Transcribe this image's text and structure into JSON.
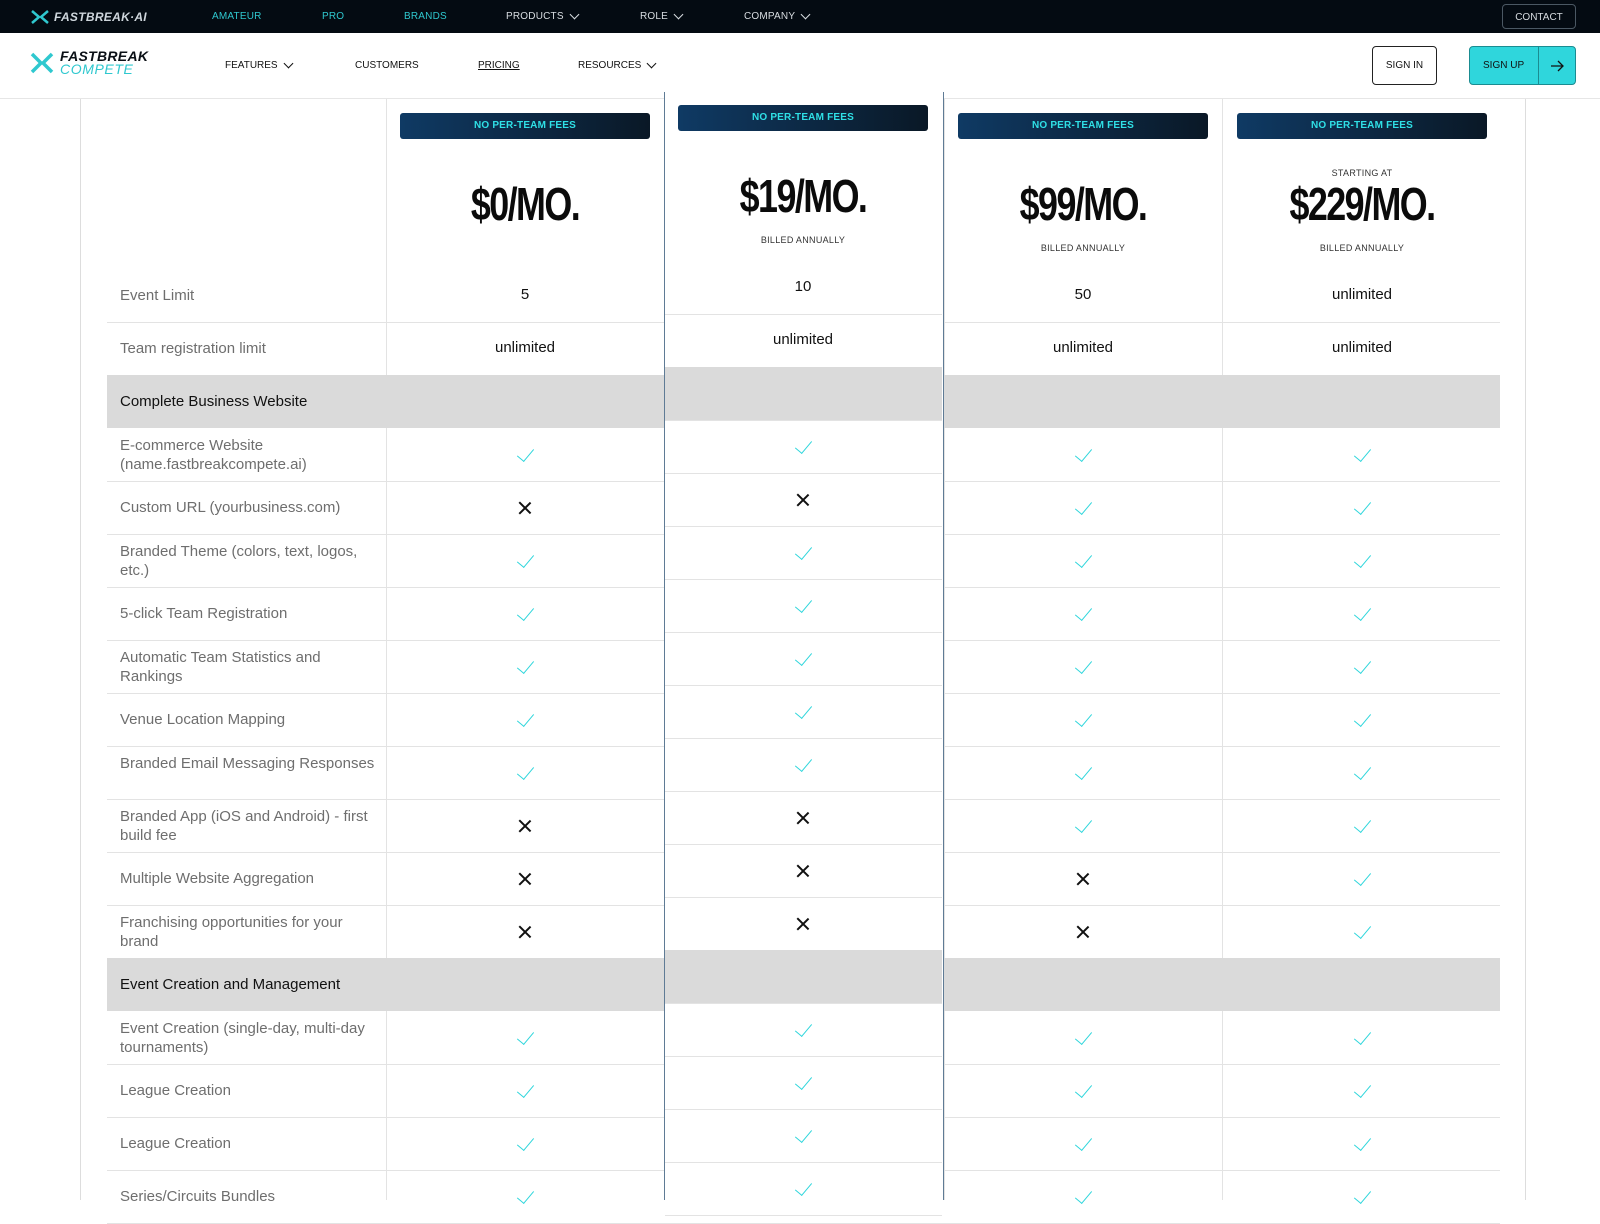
{
  "topbar": {
    "logo": "FASTBREAK·AI",
    "nav": [
      {
        "label": "AMATEUR"
      },
      {
        "label": "PRO"
      },
      {
        "label": "BRANDS"
      },
      {
        "label": "PRODUCTS"
      },
      {
        "label": "ROLE"
      },
      {
        "label": "COMPANY"
      }
    ],
    "contact_label": "CONTACT"
  },
  "mainnav": {
    "brand_line1": "FASTBREAK",
    "brand_line2": "COMPETE",
    "items": [
      {
        "label": "FEATURES"
      },
      {
        "label": "CUSTOMERS"
      },
      {
        "label": "PRICING"
      },
      {
        "label": "RESOURCES"
      }
    ],
    "signin_label": "SIGN IN",
    "signup_label": "SIGN UP"
  },
  "plans": [
    {
      "badge": "NO PER-TEAM FEES",
      "prefix": "",
      "price": "$0/MO.",
      "billing": ""
    },
    {
      "badge": "NO PER-TEAM FEES",
      "prefix": "",
      "price": "$19/MO.",
      "billing": "BILLED ANNUALLY"
    },
    {
      "badge": "NO PER-TEAM FEES",
      "prefix": "",
      "price": "$99/MO.",
      "billing": "BILLED ANNUALLY"
    },
    {
      "badge": "NO PER-TEAM FEES",
      "prefix": "STARTING AT",
      "price": "$229/MO.",
      "billing": "BILLED ANNUALLY"
    }
  ],
  "rows": [
    {
      "label": "Event Limit",
      "values": [
        "5",
        "10",
        "50",
        "unlimited"
      ]
    },
    {
      "label": "Team registration limit",
      "values": [
        "unlimited",
        "unlimited",
        "unlimited",
        "unlimited"
      ]
    },
    {
      "label": "Complete Business Website",
      "section": true
    },
    {
      "label": "E-commerce Website (name.fastbreakcompete.ai)",
      "values": [
        "check",
        "check",
        "check",
        "check"
      ]
    },
    {
      "label": "Custom URL (yourbusiness.com)",
      "values": [
        "x",
        "x",
        "check",
        "check"
      ]
    },
    {
      "label": "Branded Theme (colors, text, logos, etc.)",
      "values": [
        "check",
        "check",
        "check",
        "check"
      ]
    },
    {
      "label": "5-click Team Registration",
      "values": [
        "check",
        "check",
        "check",
        "check"
      ]
    },
    {
      "label": "Automatic Team Statistics and Rankings",
      "values": [
        "check",
        "check",
        "check",
        "check"
      ]
    },
    {
      "label": "Venue Location Mapping",
      "values": [
        "check",
        "check",
        "check",
        "check"
      ]
    },
    {
      "label": "Branded Email Messaging Responses",
      "values": [
        "check",
        "check",
        "check",
        "check"
      ]
    },
    {
      "label": "Branded App (iOS and Android) - first build fee",
      "values": [
        "x",
        "x",
        "check",
        "check"
      ]
    },
    {
      "label": "Multiple Website Aggregation",
      "values": [
        "x",
        "x",
        "x",
        "check"
      ]
    },
    {
      "label": "Franchising opportunities for your brand",
      "values": [
        "x",
        "x",
        "x",
        "check"
      ]
    },
    {
      "label": "Event Creation and Management",
      "section": true
    },
    {
      "label": "Event Creation (single-day, multi-day tournaments)",
      "values": [
        "check",
        "check",
        "check",
        "check"
      ]
    },
    {
      "label": "League Creation",
      "values": [
        "check",
        "check",
        "check",
        "check"
      ]
    },
    {
      "label": "League Creation",
      "values": [
        "check",
        "check",
        "check",
        "check"
      ]
    },
    {
      "label": "Series/Circuits Bundles",
      "values": [
        "check",
        "check",
        "check",
        "check"
      ]
    }
  ],
  "colors": {
    "accent": "#2fd6dc",
    "dark": "#040b12",
    "section_bg": "#dadada",
    "highlight_border": "#5f7b95"
  },
  "icons": [
    "chevron-down-icon",
    "check-icon",
    "x-icon",
    "arrow-right-icon",
    "chevron-up-icon"
  ]
}
